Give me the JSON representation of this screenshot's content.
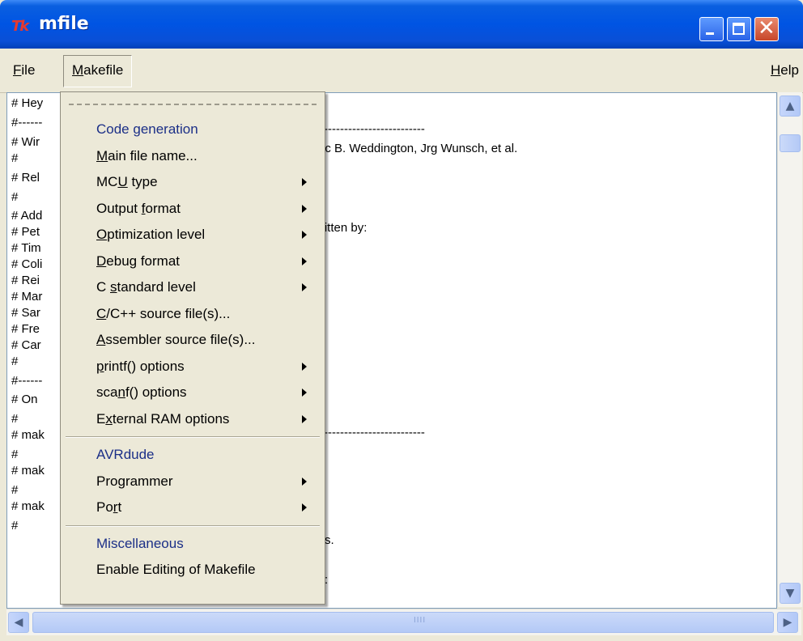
{
  "window": {
    "title": "mfile",
    "app_icon": "Tk",
    "minimize_label": "minimize",
    "maximize_label": "maximize",
    "close_label": "close"
  },
  "menubar": {
    "file": {
      "underline": "F",
      "rest": "ile"
    },
    "makefile": {
      "underline": "M",
      "rest": "akefile"
    },
    "help": {
      "underline": "H",
      "rest": "elp"
    }
  },
  "editor": {
    "left_column": [
      "# Hey",
      "#------",
      "# Wir",
      "#",
      "# Rel",
      "#",
      "# Add",
      "# Pet",
      "# Tim",
      "# Coli",
      "# Rei",
      "# Mar",
      "# Sar",
      "# Fre",
      "# Car",
      "#",
      "#------",
      "# On",
      "#",
      "# mak",
      "#",
      "# mak",
      "#",
      "# mak",
      "#"
    ],
    "right_fragments": {
      "dashes_top": "----------------------------",
      "authors": "Eric B. Weddington, Jrg Wunsch, et al.",
      "written_by": "written by:",
      "dashes_mid": "----------------------------",
      "s_dot": "s.",
      "tail": ":"
    }
  },
  "makefile_menu": {
    "sections": [
      {
        "header": "Code generation",
        "items": [
          {
            "pre": "",
            "u": "M",
            "post": "ain file name...",
            "submenu": false
          },
          {
            "pre": "MC",
            "u": "U",
            "post": " type",
            "submenu": true
          },
          {
            "pre": "Output ",
            "u": "f",
            "post": "ormat",
            "submenu": true
          },
          {
            "pre": "",
            "u": "O",
            "post": "ptimization level",
            "submenu": true
          },
          {
            "pre": "",
            "u": "D",
            "post": "ebug format",
            "submenu": true
          },
          {
            "pre": "C ",
            "u": "s",
            "post": "tandard level",
            "submenu": true
          },
          {
            "pre": "",
            "u": "C",
            "post": "/C++ source file(s)...",
            "submenu": false
          },
          {
            "pre": "",
            "u": "A",
            "post": "ssembler source file(s)...",
            "submenu": false
          },
          {
            "pre": "",
            "u": "p",
            "post": "rintf() options",
            "submenu": true
          },
          {
            "pre": "sca",
            "u": "n",
            "post": "f() options",
            "submenu": true
          },
          {
            "pre": "E",
            "u": "x",
            "post": "ternal RAM options",
            "submenu": true
          }
        ]
      },
      {
        "header": "AVRdude",
        "items": [
          {
            "pre": "Pro",
            "u": "g",
            "post": "rammer",
            "submenu": true
          },
          {
            "pre": "Po",
            "u": "r",
            "post": "t",
            "submenu": true
          }
        ]
      },
      {
        "header": "Miscellaneous",
        "items": [
          {
            "pre": "Enable Editing of Makefile",
            "u": "",
            "post": "",
            "submenu": false
          }
        ]
      }
    ]
  },
  "scrollbars": {
    "up_icon": "▲",
    "down_icon": "▼",
    "left_icon": "◀",
    "right_icon": "▶",
    "grip": "IIII"
  }
}
